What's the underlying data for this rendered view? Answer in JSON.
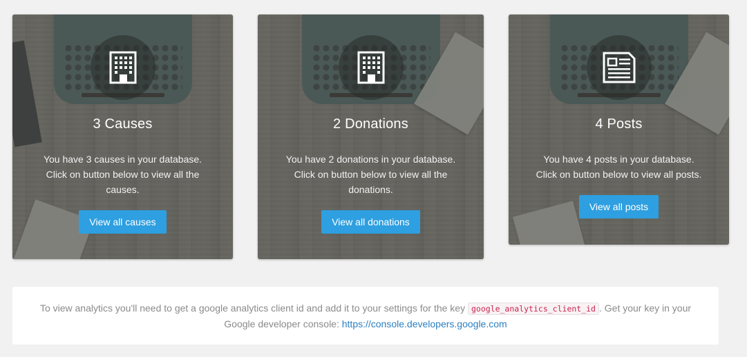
{
  "cards": [
    {
      "icon": "building-icon",
      "title": "3 Causes",
      "description": "You have 3 causes in your database. Click on button below to view all the causes.",
      "button": "View all causes"
    },
    {
      "icon": "building-icon",
      "title": "2 Donations",
      "description": "You have 2 donations in your database. Click on button below to view all the donations.",
      "button": "View all donations"
    },
    {
      "icon": "newspaper-icon",
      "title": "4 Posts",
      "description": "You have 4 posts in your database. Click on button below to view all posts.",
      "button": "View all posts"
    }
  ],
  "notice": {
    "text_before": "To view analytics you'll need to get a google analytics client id and add it to your settings for the key ",
    "key": "google_analytics_client_id",
    "text_after": ". Get your key in your Google developer console: ",
    "link": "https://console.developers.google.com"
  },
  "colors": {
    "button": "#2e9fe0",
    "code_text": "#c7254e",
    "link": "#2a7fc0"
  }
}
